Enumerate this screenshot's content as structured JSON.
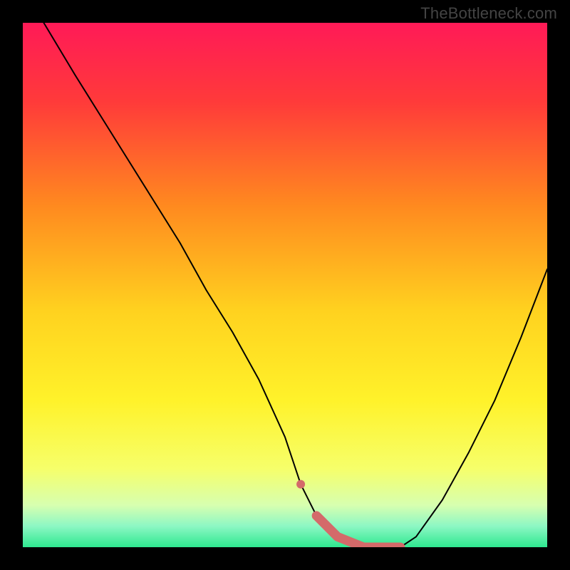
{
  "watermark": "TheBottleneck.com",
  "chart_data": {
    "type": "line",
    "title": "",
    "xlabel": "",
    "ylabel": "",
    "xlim": [
      0,
      100
    ],
    "ylim": [
      0,
      100
    ],
    "series": [
      {
        "name": "bottleneck-curve",
        "x": [
          4,
          10,
          15,
          20,
          25,
          30,
          35,
          40,
          45,
          50,
          53,
          56,
          60,
          65,
          70,
          72,
          75,
          80,
          85,
          90,
          95,
          100
        ],
        "y": [
          100,
          90,
          82,
          74,
          66,
          58,
          49,
          41,
          32,
          21,
          12,
          6,
          2,
          0,
          0,
          0,
          2,
          9,
          18,
          28,
          40,
          53
        ],
        "color": "#000000"
      },
      {
        "name": "highlight-flat",
        "x": [
          56,
          60,
          65,
          70,
          72
        ],
        "y": [
          6,
          2,
          0,
          0,
          0
        ],
        "color": "#d46a6a"
      },
      {
        "name": "highlight-dot",
        "x": [
          53
        ],
        "y": [
          12
        ],
        "color": "#d46a6a"
      }
    ],
    "background_gradient": {
      "stops": [
        {
          "offset": 0.0,
          "color": "#ff1a57"
        },
        {
          "offset": 0.15,
          "color": "#ff3a3a"
        },
        {
          "offset": 0.35,
          "color": "#ff8a1f"
        },
        {
          "offset": 0.55,
          "color": "#ffd21f"
        },
        {
          "offset": 0.72,
          "color": "#fff22a"
        },
        {
          "offset": 0.85,
          "color": "#f6ff6a"
        },
        {
          "offset": 0.92,
          "color": "#d7ffb0"
        },
        {
          "offset": 0.96,
          "color": "#8cf7c4"
        },
        {
          "offset": 1.0,
          "color": "#2ee88f"
        }
      ]
    }
  }
}
